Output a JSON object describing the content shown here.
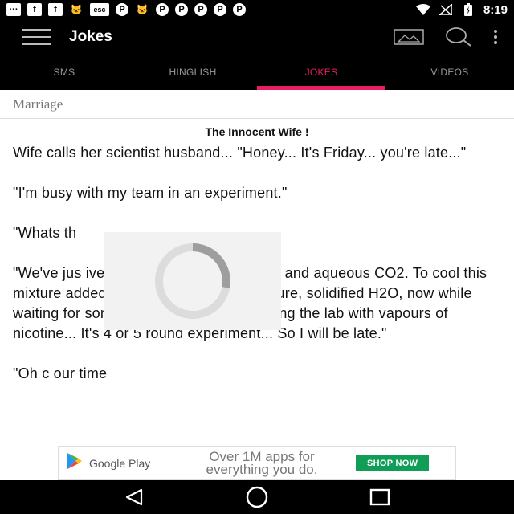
{
  "status_bar": {
    "notification_icons": [
      {
        "name": "messages-icon",
        "glyph": "···",
        "style": "box"
      },
      {
        "name": "facebook-icon",
        "glyph": "f",
        "style": "box"
      },
      {
        "name": "facebook-icon",
        "glyph": "f",
        "style": "box"
      },
      {
        "name": "cat-icon",
        "glyph": "🐱",
        "style": "plain"
      },
      {
        "name": "esc-icon",
        "glyph": "esc",
        "style": "esc"
      },
      {
        "name": "pinterest-icon",
        "glyph": "P",
        "style": "circle"
      },
      {
        "name": "cat-icon",
        "glyph": "🐱",
        "style": "plain"
      },
      {
        "name": "pinterest-icon",
        "glyph": "P",
        "style": "circle"
      },
      {
        "name": "pinterest-icon",
        "glyph": "P",
        "style": "circle"
      },
      {
        "name": "pinterest-icon",
        "glyph": "P",
        "style": "circle"
      },
      {
        "name": "pinterest-icon",
        "glyph": "P",
        "style": "circle"
      },
      {
        "name": "pinterest-icon",
        "glyph": "P",
        "style": "circle"
      }
    ],
    "time": "8:19"
  },
  "toolbar": {
    "title": "Jokes"
  },
  "tabs": [
    {
      "label": "SMS",
      "active": false
    },
    {
      "label": "HINGLISH",
      "active": false
    },
    {
      "label": "JOKES",
      "active": true
    },
    {
      "label": "VIDEOS",
      "active": false
    }
  ],
  "content": {
    "category": "Marriage",
    "title": "The Innocent Wife !",
    "paragraphs": [
      "Wife calls her scientist husband... \"Honey... It's Friday... you're late...\"",
      "\"I'm busy with my team in an experiment.\"",
      "\"Whats th",
      "\"We've jus                       ive of C2H5OH with ambient t                       and aqueous CO2. To cool this mixture added some super low temperature, solidified H2O, now while waiting for some protein, we are fumigating the lab with vapours of nicotine... It's 4 or 5 round experiment... So I will be late.\"",
      "\"Oh c                                                                                        our time"
    ]
  },
  "ad": {
    "brand": "Google Play",
    "text": "Over 1M apps for everything you do.",
    "button": "SHOP NOW"
  },
  "colors": {
    "accent": "#e91e63",
    "shop_button": "#0f9d58"
  }
}
